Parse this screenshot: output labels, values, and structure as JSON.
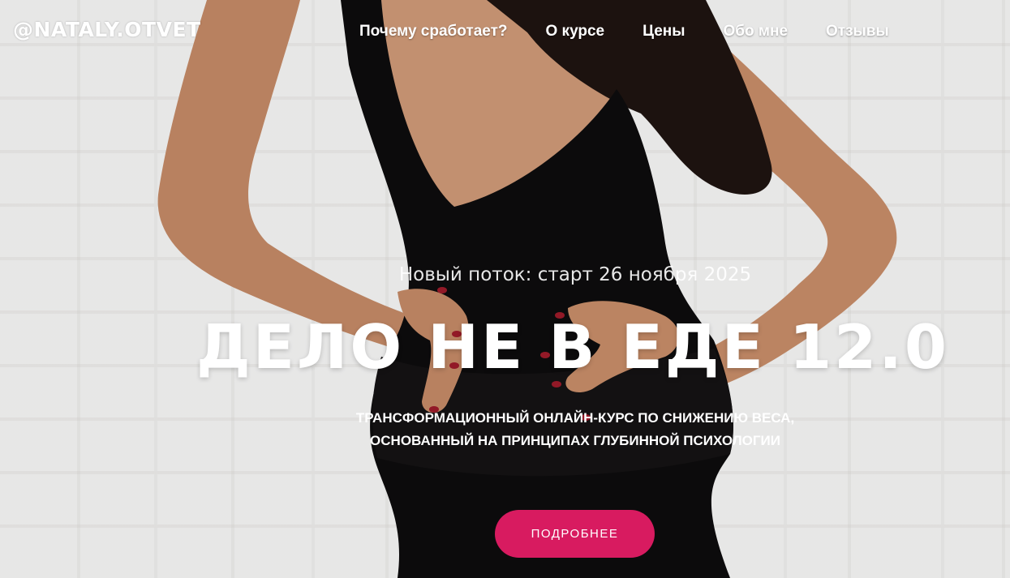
{
  "header": {
    "logo": "@NATALY.OTVET",
    "nav": [
      {
        "label": "Почему сработает?"
      },
      {
        "label": "О курсе"
      },
      {
        "label": "Цены"
      },
      {
        "label": "Обо мне"
      },
      {
        "label": "Отзывы"
      }
    ]
  },
  "hero": {
    "start_date_text": "Новый поток: старт 26 ноября 2025",
    "title": "ДЕЛО НЕ В ЕДЕ 12.0",
    "description_line1": "ТРАНСФОРМАЦИОННЫЙ ОНЛАЙН-КУРС ПО СНИЖЕНИЮ ВЕСА,",
    "description_line2": "ОСНОВАННЫЙ НА ПРИНЦИПАХ ГЛУБИННОЙ ПСИХОЛОГИИ",
    "cta_label": "ПОДРОБНЕЕ"
  },
  "colors": {
    "accent": "#d81b60",
    "text": "#ffffff",
    "background": "#ececea",
    "dress": "#0d0c0d",
    "skin": "#c9906d",
    "hair": "#1e1410"
  }
}
